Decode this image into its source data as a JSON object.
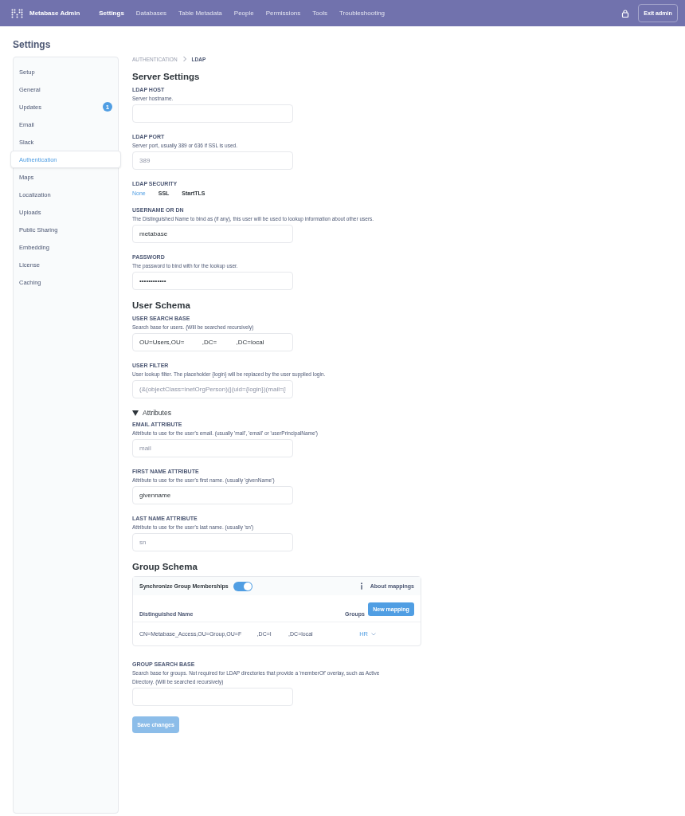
{
  "navbar": {
    "brand": "Metabase Admin",
    "items": [
      {
        "label": "Settings",
        "selected": true
      },
      {
        "label": "Databases",
        "selected": false
      },
      {
        "label": "Table Metadata",
        "selected": false
      },
      {
        "label": "People",
        "selected": false
      },
      {
        "label": "Permissions",
        "selected": false
      },
      {
        "label": "Tools",
        "selected": false
      },
      {
        "label": "Troubleshooting",
        "selected": false
      }
    ],
    "exit_button": "Exit admin"
  },
  "page_title": "Settings",
  "sidebar": {
    "items": [
      {
        "label": "Setup",
        "selected": false
      },
      {
        "label": "General",
        "selected": false
      },
      {
        "label": "Updates",
        "selected": false,
        "badge": "1"
      },
      {
        "label": "Email",
        "selected": false
      },
      {
        "label": "Slack",
        "selected": false
      },
      {
        "label": "Authentication",
        "selected": true
      },
      {
        "label": "Maps",
        "selected": false
      },
      {
        "label": "Localization",
        "selected": false
      },
      {
        "label": "Uploads",
        "selected": false
      },
      {
        "label": "Public Sharing",
        "selected": false
      },
      {
        "label": "Embedding",
        "selected": false
      },
      {
        "label": "License",
        "selected": false
      },
      {
        "label": "Caching",
        "selected": false
      }
    ]
  },
  "breadcrumb": [
    "AUTHENTICATION",
    "LDAP"
  ],
  "sections": [
    {
      "kind": "heading",
      "text": "Server Settings"
    },
    {
      "kind": "field",
      "label": "LDAP HOST",
      "description": "Server hostname."
    },
    {
      "kind": "field",
      "label": "LDAP PORT",
      "description": "Server port, usually 389 or 636 if SSL is used.",
      "placeholder": "389"
    },
    {
      "kind": "options",
      "label": "LDAP SECURITY",
      "options": [
        {
          "label": "None",
          "selected": true
        },
        {
          "label": "SSL",
          "selected": false
        },
        {
          "label": "StartTLS",
          "selected": false
        }
      ]
    },
    {
      "kind": "field",
      "label": "USERNAME OR DN",
      "description": "The Distinguished Name to bind as (if any), this user will be used to lookup information about other users.",
      "value": "metabase"
    },
    {
      "kind": "field",
      "label": "PASSWORD",
      "description": "The password to bind with for the lookup user.",
      "value": "••••••••••••"
    },
    {
      "kind": "heading",
      "text": "User Schema"
    },
    {
      "kind": "field",
      "label": "USER SEARCH BASE",
      "description": "Search base for users. (Will be searched recursively)",
      "value": "OU=Users,OU=          ,DC=           ,DC=local"
    },
    {
      "kind": "field",
      "label": "USER FILTER",
      "description": "User lookup filter. The placeholder {login} will be replaced by the user supplied login.",
      "placeholder": "(&(objectClass=inetOrgPerson)(|(uid={login})(mail={l"
    },
    {
      "kind": "toggle",
      "text": "Attributes",
      "expanded": true
    },
    {
      "kind": "field",
      "label": "EMAIL ATTRIBUTE",
      "description": "Attribute to use for the user's email. (usually 'mail', 'email' or 'userPrincipalName')",
      "placeholder": "mail"
    },
    {
      "kind": "field",
      "label": "FIRST NAME ATTRIBUTE",
      "description": "Attribute to use for the user's first name. (usually 'givenName')",
      "value": "givenname"
    },
    {
      "kind": "field",
      "label": "LAST NAME ATTRIBUTE",
      "description": "Attribute to use for the user's last name. (usually 'sn')",
      "placeholder": "sn"
    },
    {
      "kind": "heading",
      "text": "Group Schema"
    },
    {
      "kind": "mappings",
      "sync_label": "Synchronize Group Memberships",
      "sync_on": true,
      "about": "About mappings",
      "new_button": "New mapping",
      "columns": [
        "Distinguished Name",
        "Groups"
      ],
      "rows": [
        {
          "dn": "CN=Metabase_Access,OU=Group,OU=F          ,DC=I           ,DC=local",
          "group": "HR"
        }
      ]
    },
    {
      "kind": "field",
      "label": "GROUP SEARCH BASE",
      "description": "Search base for groups. Not required for LDAP directories that provide a 'memberOf' overlay, such as Active Directory. (Will be searched recursively)"
    }
  ],
  "save_button": {
    "label": "Save changes",
    "disabled": true
  }
}
